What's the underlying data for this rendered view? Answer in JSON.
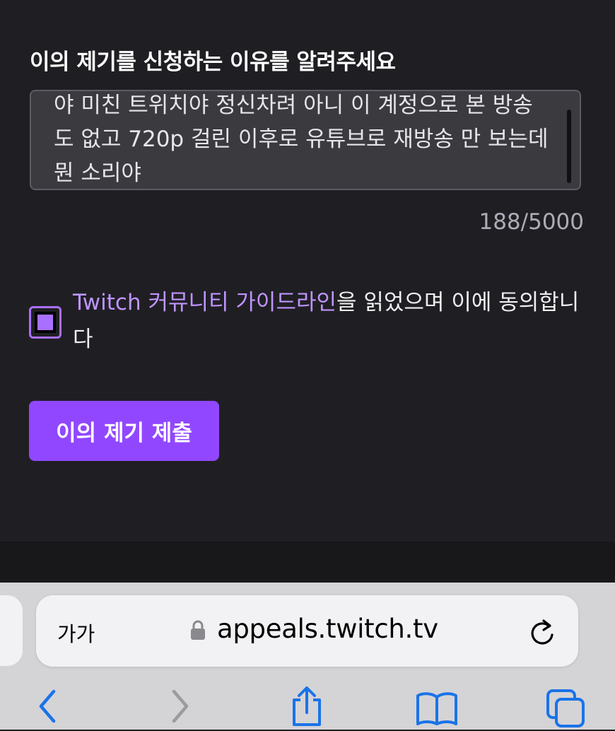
{
  "form": {
    "title": "이의 제기를 신청하는 이유를 알려주세요",
    "reason_text": "야 미친 트위치야 정신차려 아니 이 계정으로 본 방송도 없고 720p 걸린 이후로 유튜브로 재방송 만 보는데 뭔 소리야",
    "char_count": "188/5000",
    "agree_link": "Twitch 커뮤니티 가이드라인",
    "agree_suffix": "을 읽었으며 이에 동의합니다",
    "checkbox_checked": true,
    "submit_label": "이의 제기 제출"
  },
  "browser": {
    "text_size_label": "가가",
    "url": "appeals.twitch.tv"
  },
  "icons": {
    "lock": "lock-icon",
    "reload": "reload-icon",
    "back": "chevron-left-icon",
    "forward": "chevron-right-icon",
    "share": "share-icon",
    "bookmarks": "book-icon",
    "tabs": "tabs-icon"
  },
  "colors": {
    "accent": "#9147ff",
    "link": "#bf94ff",
    "background": "#1f1f23",
    "ios_blue": "#1a73e8"
  }
}
